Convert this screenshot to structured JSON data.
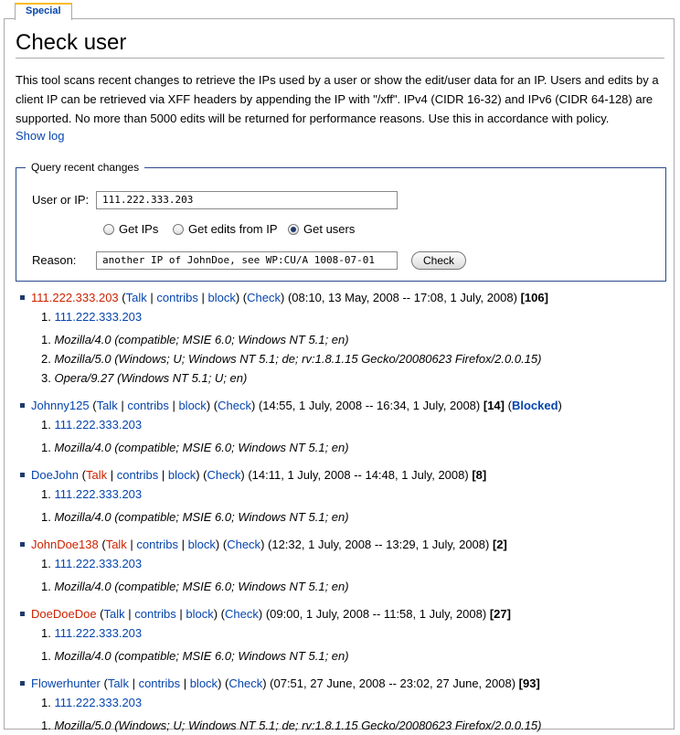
{
  "tab": {
    "label": "Special"
  },
  "title": "Check user",
  "intro": "This tool scans recent changes to retrieve the IPs used by a user or show the edit/user data for an IP. Users and edits by a client IP can be retrieved via XFF headers by appending the IP with \"/xff\". IPv4 (CIDR 16-32) and IPv6 (CIDR 64-128) are supported. No more than 5000 edits will be returned for performance reasons. Use this in accordance with policy.",
  "show_log": "Show log",
  "form": {
    "legend": "Query recent changes",
    "user_label": "User or IP:",
    "user_value": "111.222.333.203",
    "radio_ips": "Get IPs",
    "radio_edits": "Get edits from IP",
    "radio_users": "Get users",
    "selected": "Get users",
    "reason_label": "Reason:",
    "reason_value": "another IP of JohnDoe, see WP:CU/A 1008-07-01",
    "check_button": "Check"
  },
  "links": {
    "talk": "Talk",
    "contribs": "contribs",
    "block": "block",
    "check": "Check",
    "sep": "|"
  },
  "results": [
    {
      "name": "111.222.333.203",
      "name_red": true,
      "talk_red": false,
      "range": "(08:10, 13 May, 2008 -- 17:08, 1 July, 2008)",
      "count": "[106]",
      "blocked": "",
      "ips": [
        "111.222.333.203"
      ],
      "agents": [
        "Mozilla/4.0 (compatible; MSIE 6.0; Windows NT 5.1; en)",
        "Mozilla/5.0 (Windows; U; Windows NT 5.1; de; rv:1.8.1.15 Gecko/20080623 Firefox/2.0.0.15)",
        "Opera/9.27 (Windows NT 5.1; U; en)"
      ]
    },
    {
      "name": "Johnny125",
      "name_red": false,
      "talk_red": false,
      "range": "(14:55, 1 July, 2008 -- 16:34, 1 July, 2008)",
      "count": "[14]",
      "blocked": "Blocked",
      "ips": [
        "111.222.333.203"
      ],
      "agents": [
        "Mozilla/4.0 (compatible; MSIE 6.0; Windows NT 5.1; en)"
      ]
    },
    {
      "name": "DoeJohn",
      "name_red": false,
      "talk_red": true,
      "range": "(14:11, 1 July, 2008 -- 14:48, 1 July, 2008)",
      "count": "[8]",
      "blocked": "",
      "ips": [
        "111.222.333.203"
      ],
      "agents": [
        "Mozilla/4.0 (compatible; MSIE 6.0; Windows NT 5.1; en)"
      ]
    },
    {
      "name": "JohnDoe138",
      "name_red": true,
      "talk_red": true,
      "range": "(12:32, 1 July, 2008 -- 13:29, 1 July, 2008)",
      "count": "[2]",
      "blocked": "",
      "ips": [
        "111.222.333.203"
      ],
      "agents": [
        "Mozilla/4.0 (compatible; MSIE 6.0; Windows NT 5.1; en)"
      ]
    },
    {
      "name": "DoeDoeDoe",
      "name_red": true,
      "talk_red": false,
      "range": "(09:00, 1 July, 2008 -- 11:58, 1 July, 2008)",
      "count": "[27]",
      "blocked": "",
      "ips": [
        "111.222.333.203"
      ],
      "agents": [
        "Mozilla/4.0 (compatible; MSIE 6.0; Windows NT 5.1; en)"
      ]
    },
    {
      "name": "Flowerhunter",
      "name_red": false,
      "talk_red": false,
      "range": "(07:51, 27 June, 2008 -- 23:02, 27 June, 2008)",
      "count": "[93]",
      "blocked": "",
      "ips": [
        "111.222.333.203"
      ],
      "agents": [
        "Mozilla/5.0 (Windows; U; Windows NT 5.1; de; rv:1.8.1.15 Gecko/20080623 Firefox/2.0.0.15)"
      ]
    }
  ]
}
